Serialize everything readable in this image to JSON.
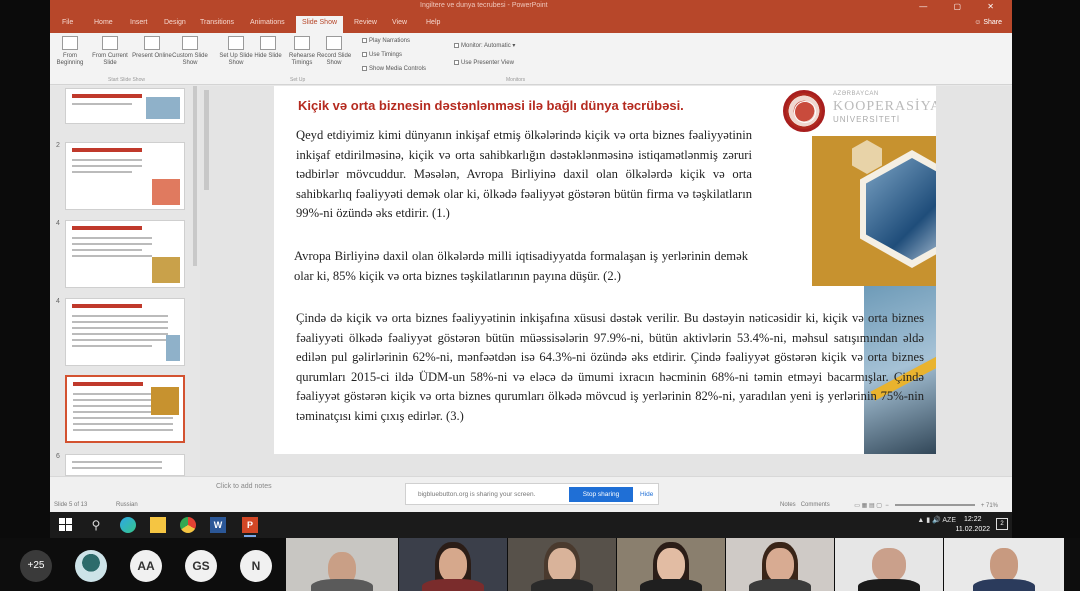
{
  "window": {
    "title": "Ingiltere ve dunya tecrubesi - PowerPoint",
    "share_label": "Share"
  },
  "ribbon": {
    "tabs": [
      "File",
      "Home",
      "Insert",
      "Design",
      "Transitions",
      "Animations",
      "Slide Show",
      "Review",
      "View",
      "Help"
    ],
    "active_tab": "Slide Show",
    "buttons": {
      "from_beginning": "From Beginning",
      "from_current": "From Current Slide",
      "present_online": "Present Online",
      "custom_show": "Custom Slide Show",
      "set_up": "Set Up Slide Show",
      "hide_slide": "Hide Slide",
      "rehearse": "Rehearse Timings",
      "record": "Record Slide Show"
    },
    "checks": {
      "play_narrations": "Play Narrations",
      "use_timings": "Use Timings",
      "show_media": "Show Media Controls",
      "monitor": "Monitor:",
      "monitor_value": "Automatic",
      "presenter_view": "Use Presenter View"
    },
    "groups": {
      "start": "Start Slide Show",
      "set_up": "Set Up",
      "monitors": "Monitors"
    }
  },
  "thumbnails": [
    {
      "number": "",
      "active": false
    },
    {
      "number": "2",
      "active": false
    },
    {
      "number": "4",
      "active": false
    },
    {
      "number": "4",
      "active": false
    },
    {
      "number": "5",
      "active": true
    },
    {
      "number": "6",
      "active": false
    }
  ],
  "slide": {
    "title": "Kiçik və orta biznesin dəstənlənməsi ilə bağlı dünya təcrübəsi.",
    "paragraph_1": "Qeyd etdiyimiz kimi dünyanın inkişaf etmiş ölkələrində kiçik və orta biznes fəaliyyətinin inkişaf etdirilməsinə, kiçik və orta sahibkarlığın dəstəklənməsinə istiqamətlənmiş zəruri tədbirlər mövcuddur. Məsələn, Avropa Birliyinə daxil olan ölkələrdə kiçik və orta sahibkarlıq fəaliyyəti demək olar ki, ölkədə fəaliyyət göstərən bütün firma və təşkilatların 99%-ni özündə əks etdirir. (1.)",
    "paragraph_2": "Avropa Birliyinə daxil olan ölkələrdə milli iqtisadiyyatda formalaşan iş yerlərinin demək olar ki, 85% kiçik və orta biznes təşkilatlarının payına düşür. (2.)",
    "paragraph_3": "Çində də kiçik və orta biznes fəaliyyətinin inkişafına xüsusi dəstək verilir. Bu dəstəyin nəticəsidir ki, kiçik və orta biznes fəaliyyəti ölkədə fəaliyyət göstərən bütün müəssisələrin 97.9%-ni, bütün aktivlərin 53.4%-ni, məhsul satışımından əldə edilən pul gəlirlərinin 62%-ni, mənfəətdən isə 64.3%-ni özündə əks etdirir. Çində fəaliyyət göstərən kiçik və orta biznes qurumları 2015-ci ildə ÜDM-un 58%-ni və eləcə də ümumi ixracın həcminin 68%-ni təmin etməyi bacarmışlar. Çində fəaliyyət göstərən kiçik və orta biznes qurumları ölkədə mövcud iş yerlərinin 82%-ni, yaradılan yeni iş yerlərinin 75%-nin təminatçısı kimi çıxış edirlər. (3.)",
    "logo_line1": "AZƏRBAYCAN",
    "logo_line2": "KOOPERASİYA",
    "logo_line3": "UNİVERSİTETİ"
  },
  "status": {
    "notes_hint": "Click to add notes",
    "slide_counter": "Slide 5 of 13",
    "language": "Russian",
    "share_msg": "bigbluebutton.org is sharing your screen.",
    "stop_sharing": "Stop sharing",
    "hide": "Hide",
    "notes": "Notes",
    "comments": "Comments",
    "zoom": "71%"
  },
  "taskbar": {
    "lang": "AZE",
    "time": "12:22",
    "date": "11.02.2022"
  },
  "participants": {
    "more_count": "+25",
    "initials": [
      "AA",
      "GS",
      "N"
    ]
  }
}
